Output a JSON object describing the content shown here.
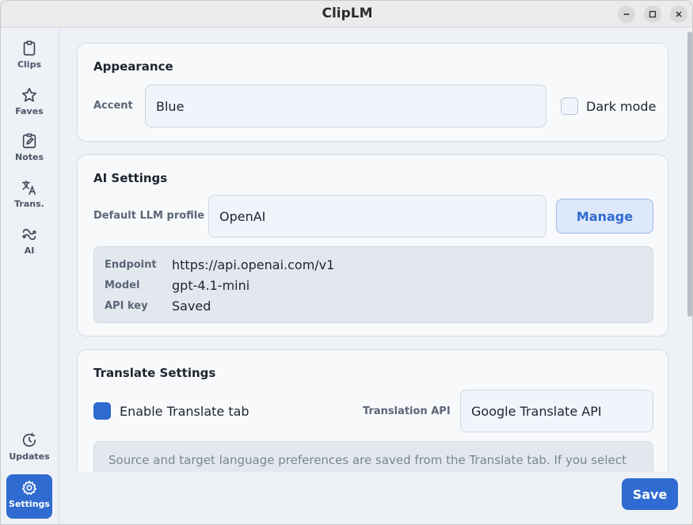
{
  "window": {
    "title": "ClipLM",
    "controls": [
      "minimize-icon",
      "maximize-icon",
      "close-icon"
    ]
  },
  "sidebar": {
    "items": [
      {
        "label": "Clips",
        "icon": "clipboard-icon"
      },
      {
        "label": "Faves",
        "icon": "star-icon"
      },
      {
        "label": "Notes",
        "icon": "note-edit-icon"
      },
      {
        "label": "Trans.",
        "icon": "translate-icon"
      },
      {
        "label": "AI",
        "icon": "ai-link-icon"
      }
    ],
    "bottom_items": [
      {
        "label": "Updates",
        "icon": "update-clock-icon"
      },
      {
        "label": "Settings",
        "icon": "gear-icon",
        "active": true
      }
    ],
    "accent_color": "#2f6bd0"
  },
  "appearance": {
    "title": "Appearance",
    "accent_label": "Accent",
    "accent_value": "Blue",
    "dark_mode_label": "Dark mode",
    "dark_mode_checked": false
  },
  "ai_settings": {
    "title": "AI Settings",
    "profile_label": "Default LLM profile",
    "profile_value": "OpenAI",
    "manage_label": "Manage",
    "details": [
      {
        "key": "Endpoint",
        "value": "https://api.openai.com/v1"
      },
      {
        "key": "Model",
        "value": "gpt-4.1-mini"
      },
      {
        "key": "API key",
        "value": "Saved"
      }
    ]
  },
  "translate_settings": {
    "title": "Translate Settings",
    "enable_label": "Enable Translate tab",
    "enable_checked": true,
    "api_label": "Translation API",
    "api_value": "Google Translate API",
    "note": "Source and target language preferences are saved from the Translate tab. If you select"
  },
  "footer": {
    "save_label": "Save"
  }
}
